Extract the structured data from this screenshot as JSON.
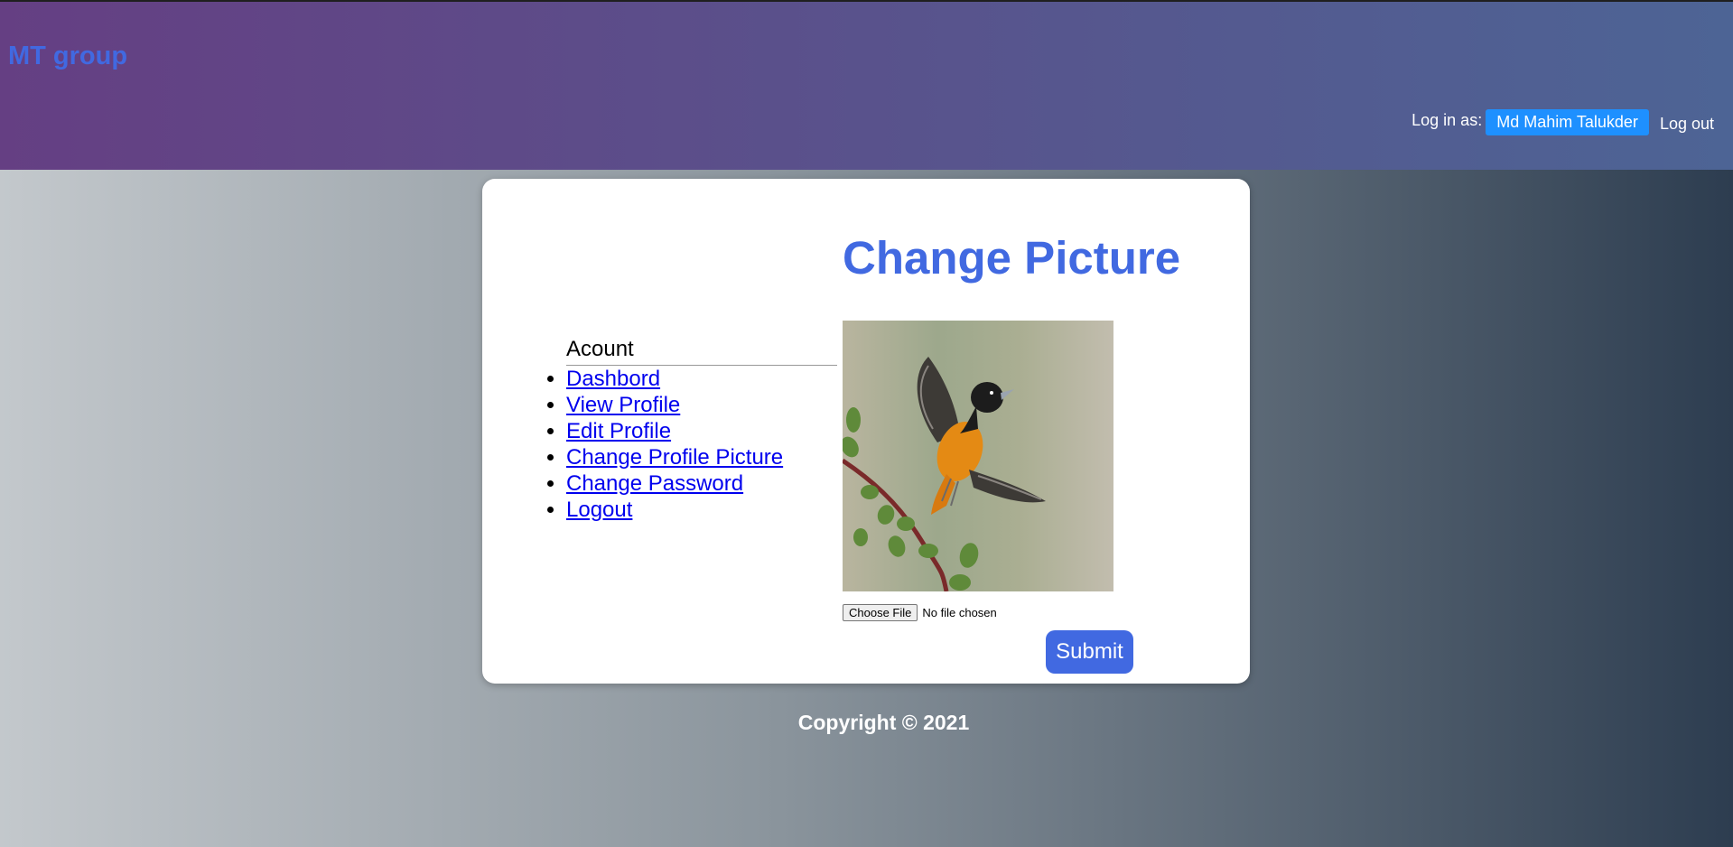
{
  "header": {
    "brand": "MT group",
    "login_label": "Log in as:",
    "user_name": "Md Mahim Talukder",
    "logout_label": "Log out"
  },
  "card": {
    "title": "Change Picture",
    "menu": {
      "title": "Acount",
      "items": [
        {
          "label": "Dashbord"
        },
        {
          "label": "View Profile"
        },
        {
          "label": "Edit Profile"
        },
        {
          "label": "Change Profile Picture"
        },
        {
          "label": "Change Password"
        },
        {
          "label": "Logout"
        }
      ]
    },
    "image": {
      "icon": "bird-photo"
    },
    "file_input": {
      "button_label": "Choose File",
      "status": "No file chosen"
    },
    "submit_label": "Submit"
  },
  "footer": {
    "copyright": "Copyright © 2021"
  },
  "colors": {
    "header_left": "#653f83",
    "header_right": "#4d6495",
    "accent": "#4169e1",
    "user_button": "#1e90ff",
    "link": "#0000ee"
  }
}
